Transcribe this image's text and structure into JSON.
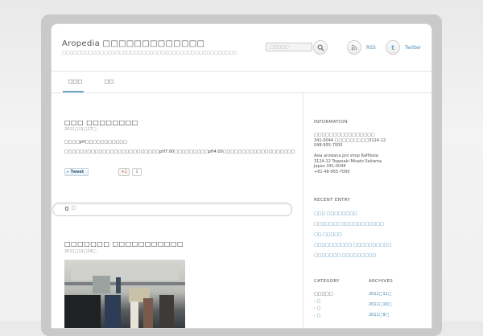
{
  "site": {
    "title": "Aropedia □□□□□□□□□□□□□",
    "description": "□□□□□□□□□□□□□□□□□□□□□□□□□□□□□□□□□□□□□□□□□□□□□□"
  },
  "search": {
    "placeholder": "□□□□□"
  },
  "social": {
    "rss_label": "RSS",
    "twitter_label": "Twitter"
  },
  "nav": {
    "items": [
      {
        "label": "□□□"
      },
      {
        "label": "□□"
      }
    ]
  },
  "posts": [
    {
      "title": "□□□ □□□□□□□□",
      "date": "2011□11□17□",
      "lines": [
        "□□□□pH□□□□□□□□□□□",
        "□□□□□□□□□□□□□□□□□□□□□□□□□pH7.00□□□□□□□□□pH4.00□□□□□□□□□□□□□□□□□□□"
      ],
      "tweet_label": "Tweet",
      "gplus_label": "+1",
      "gplus_count": "1"
    },
    {
      "title": "□□□□□□□ □□□□□□□□□□□",
      "date": "2011□11□24□"
    }
  ],
  "pill_text": "□",
  "sidebar": {
    "information": {
      "heading": "INFORMATION",
      "lines": [
        "□□□□□□□□□□□□□□□□",
        "341-0044 □□□□□□□□□3124-12",
        "048-955-7000",
        "",
        "Asia arowana pro shop Rafflesia",
        "3124-12 Togasaki Misato Saitama",
        "Japan 341-0044",
        "+81-48-955-7000"
      ]
    },
    "recent": {
      "heading": "RECENT ENTRY",
      "items": [
        "□□□ □□□□□□□□",
        "□□□□□□□ □□□□□□□□□□□",
        "□□ □□□□□",
        "□□□□□□□□□□ □□□□□□□□□□",
        "□□□□□□□ □□□□□□□□□"
      ]
    },
    "category": {
      "heading": "CATEGORY",
      "items": [
        "□□□□□",
        "□",
        "□",
        "□"
      ]
    },
    "archives": {
      "heading": "ARCHIVES",
      "items": [
        "2011□11□",
        "2011□10□",
        "2011□9□"
      ]
    }
  },
  "colors": {
    "accent": "#6fa8c7",
    "link": "#3a7fa8",
    "frame": "#c9c9c9"
  }
}
